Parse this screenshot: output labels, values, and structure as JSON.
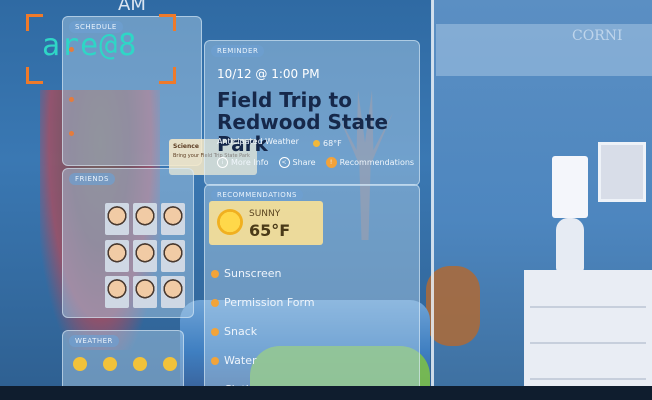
{
  "logo": {
    "text": "are@8"
  },
  "clock": {
    "text": "AM"
  },
  "watermark": {
    "text": "CORNI"
  },
  "schedule": {
    "header": "SCHEDULE",
    "card_title": "Science",
    "card_text": "Bring your Field Trip State Park"
  },
  "friends": {
    "header": "FRIENDS",
    "count": 9
  },
  "weather": {
    "header": "WEATHER"
  },
  "reminder": {
    "header": "REMINDER",
    "time": "10/12 @ 1:00 PM",
    "title_line1": "Field Trip to",
    "title_line2": "Redwood State Park",
    "subtitle": "Anticipated Weather",
    "temp": "68°F",
    "actions": {
      "more_info": "More Info",
      "share": "Share",
      "recommendations": "Recommendations"
    }
  },
  "recommendations": {
    "header": "RECOMMENDATIONS",
    "condition": "SUNNY",
    "temperature": "65°F",
    "items": [
      "Sunscreen",
      "Permission Form",
      "Snack",
      "Water",
      "Clothes"
    ]
  },
  "colors": {
    "accent_orange": "#ef7a2a",
    "logo_teal": "#2fd6c6"
  }
}
